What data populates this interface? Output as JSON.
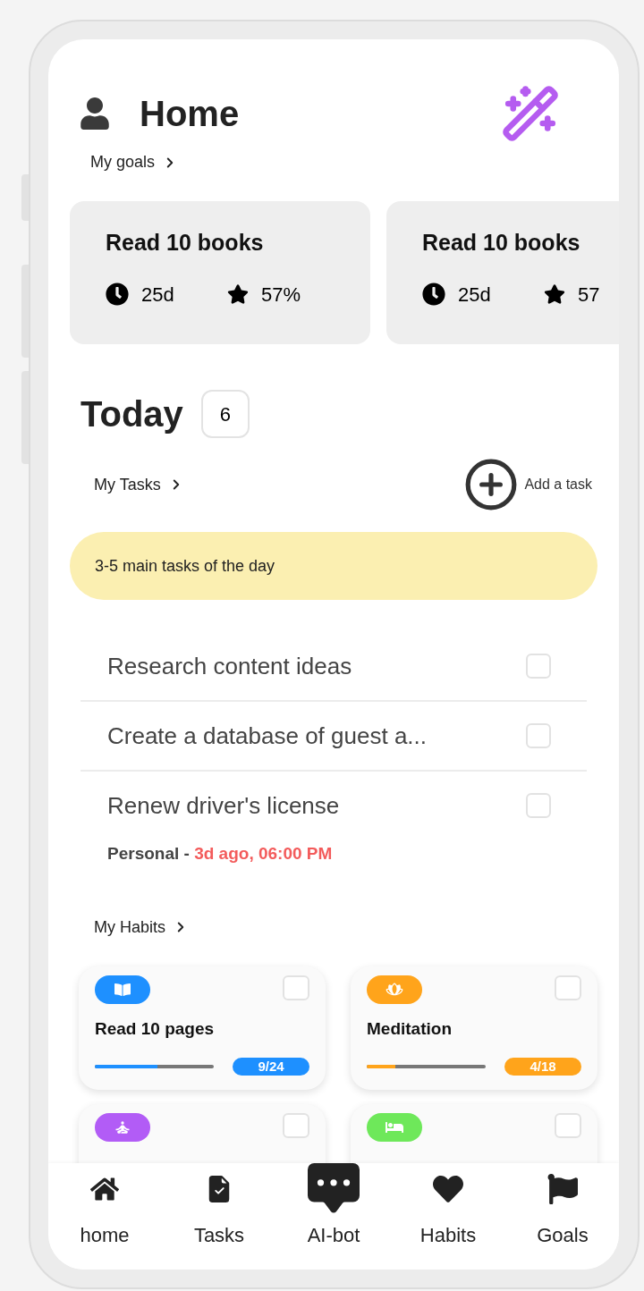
{
  "header": {
    "title": "Home"
  },
  "goals": {
    "link": "My goals",
    "cards": [
      {
        "title": "Read 10 books",
        "days": "25d",
        "percent": "57%"
      },
      {
        "title": "Read 10 books",
        "days": "25d",
        "percent": "57"
      }
    ]
  },
  "today": {
    "title": "Today",
    "count": "6"
  },
  "tasks": {
    "link": "My Tasks",
    "add_label": "Add a task",
    "banner": "3-5 main tasks of the day",
    "items": [
      {
        "title": "Research content ideas",
        "checked": false
      },
      {
        "title": "Create a database of guest a...",
        "checked": false
      },
      {
        "title": "Renew driver's license",
        "checked": false,
        "category": "Personal - ",
        "due": "3d ago, 06:00 PM"
      }
    ]
  },
  "habits": {
    "link": "My Habits",
    "items": [
      {
        "kind": "book",
        "color": "#1e90ff",
        "name": "Read 10 pages",
        "progress": "9/24",
        "level": 0.53,
        "checked": false
      },
      {
        "kind": "lotus",
        "color": "#ffa41b",
        "name": "Meditation",
        "progress": "4/18",
        "level": 0.24,
        "checked": false
      },
      {
        "kind": "yoga",
        "color": "#b25cf6",
        "checked": false
      },
      {
        "kind": "bed",
        "color": "#6ee85a",
        "checked": false
      }
    ]
  },
  "nav": [
    {
      "kind": "home",
      "label": "home"
    },
    {
      "kind": "tasks",
      "label": "Tasks"
    },
    {
      "kind": "chat",
      "label": "AI-bot"
    },
    {
      "kind": "heart",
      "label": "Habits"
    },
    {
      "kind": "flag",
      "label": "Goals"
    }
  ]
}
